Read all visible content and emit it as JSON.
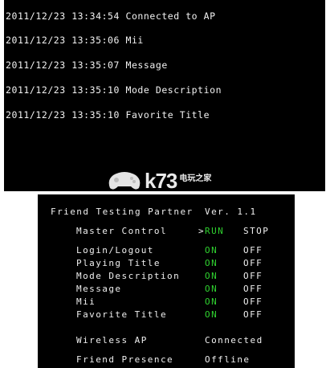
{
  "log": {
    "lines": [
      "2011/12/23 13:34:54 Connected to AP",
      "2011/12/23 13:35:06 Mii",
      "2011/12/23 13:35:07 Message",
      "2011/12/23 13:35:10 Mode Description",
      "2011/12/23 13:35:10 Favorite Title"
    ]
  },
  "watermark": {
    "brand": "k73",
    "sub": "电玩之家"
  },
  "app": {
    "title": "Friend Testing Partner",
    "version": "Ver. 1.1"
  },
  "master": {
    "label": "Master Control",
    "cursor": ">",
    "run": "RUN",
    "stop": "STOP"
  },
  "settings": [
    {
      "label": "Login/Logout",
      "on": "ON",
      "off": "OFF"
    },
    {
      "label": "Playing Title",
      "on": "ON",
      "off": "OFF"
    },
    {
      "label": "Mode Description",
      "on": "ON",
      "off": "OFF"
    },
    {
      "label": "Message",
      "on": "ON",
      "off": "OFF"
    },
    {
      "label": "Mii",
      "on": "ON",
      "off": "OFF"
    },
    {
      "label": "Favorite Title",
      "on": "ON",
      "off": "OFF"
    }
  ],
  "status": [
    {
      "label": "Wireless AP",
      "value": "Connected"
    },
    {
      "label": "Friend Presence",
      "value": "Offline"
    }
  ],
  "colors": {
    "on": "#2fd12f",
    "text": "#efefef",
    "bg": "#000000"
  }
}
